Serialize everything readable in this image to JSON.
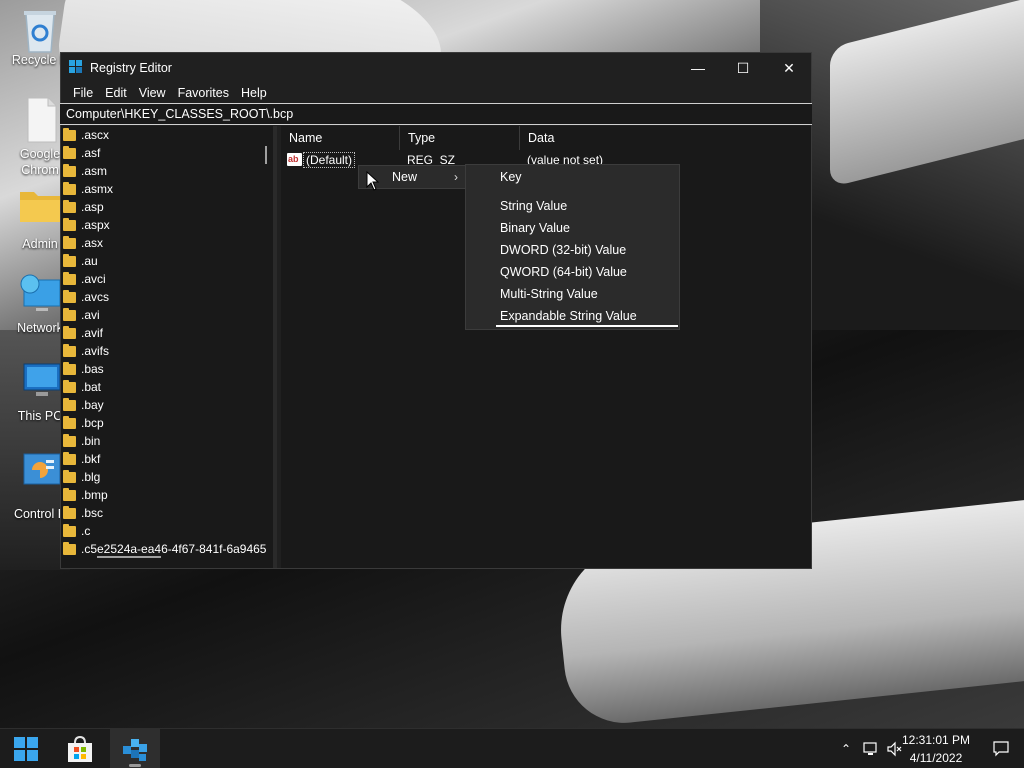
{
  "desktop": {
    "icons": [
      {
        "label": "Recycle B",
        "icon": "recycle-bin-icon"
      },
      {
        "label": "Google Chrom",
        "icon": "chrome-shortcut-icon"
      },
      {
        "label": "Admin",
        "icon": "folder-icon"
      },
      {
        "label": "Network",
        "icon": "network-icon"
      },
      {
        "label": "This PC",
        "icon": "this-pc-icon"
      },
      {
        "label": "Control P",
        "icon": "control-panel-icon"
      }
    ]
  },
  "window": {
    "title": "Registry Editor",
    "controls": {
      "minimize": "—",
      "maximize": "☐",
      "close": "✕"
    },
    "menu": [
      "File",
      "Edit",
      "View",
      "Favorites",
      "Help"
    ],
    "address": "Computer\\HKEY_CLASSES_ROOT\\.bcp",
    "tree": [
      ".ascx",
      ".asf",
      ".asm",
      ".asmx",
      ".asp",
      ".aspx",
      ".asx",
      ".au",
      ".avci",
      ".avcs",
      ".avi",
      ".avif",
      ".avifs",
      ".bas",
      ".bat",
      ".bay",
      ".bcp",
      ".bin",
      ".bkf",
      ".blg",
      ".bmp",
      ".bsc",
      ".c",
      ".c5e2524a-ea46-4f67-841f-6a9465"
    ],
    "selected_tree_item": ".bcp",
    "columns": {
      "name": "Name",
      "type": "Type",
      "data": "Data"
    },
    "rows": [
      {
        "name": "(Default)",
        "type": "REG_SZ",
        "data": "(value not set)"
      }
    ]
  },
  "context_menu": {
    "new_label": "New",
    "submenu": [
      "Key",
      "String Value",
      "Binary Value",
      "DWORD (32-bit) Value",
      "QWORD (64-bit) Value",
      "Multi-String Value",
      "Expandable String Value"
    ]
  },
  "taskbar": {
    "time": "12:31:01 PM",
    "date": "4/11/2022"
  },
  "colors": {
    "accent": "#29a3e0",
    "folder": "#e8b73a",
    "menu_bg": "#2b2b2b",
    "window_bg": "#202020"
  }
}
